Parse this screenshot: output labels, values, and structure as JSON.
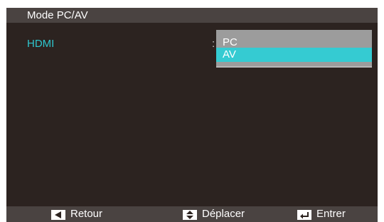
{
  "window": {
    "title": "Mode PC/AV"
  },
  "setting": {
    "label": "HDMI",
    "separator": ":",
    "dropdown": {
      "options": [
        {
          "label": "PC",
          "selected": false
        },
        {
          "label": "AV",
          "selected": true
        }
      ]
    }
  },
  "footer": {
    "back": {
      "label": "Retour",
      "icon": "left-arrow-icon"
    },
    "move": {
      "label": "Déplacer",
      "icon": "up-down-arrow-icon"
    },
    "enter": {
      "label": "Entrer",
      "icon": "enter-return-icon"
    }
  },
  "colors": {
    "background": "#2c2320",
    "bars": "#4a4341",
    "accent": "#35cbd2",
    "label_accent": "#2ec6ce",
    "dropdown_bg": "#9c9c9c"
  }
}
